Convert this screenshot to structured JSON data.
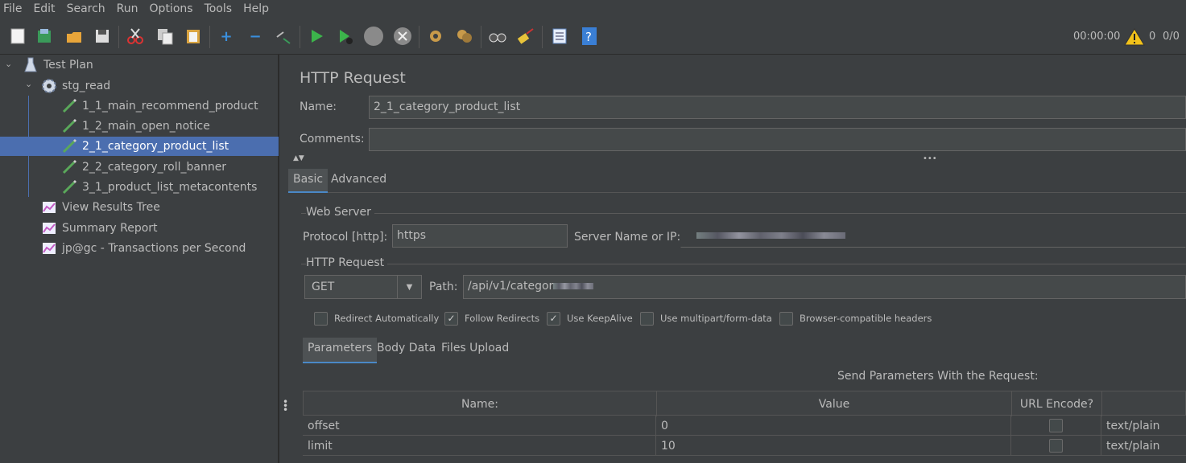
{
  "menu": [
    "File",
    "Edit",
    "Search",
    "Run",
    "Options",
    "Tools",
    "Help"
  ],
  "toolbar": {
    "icons": [
      "new-icon",
      "templates-icon",
      "open-icon",
      "save-icon",
      "cut-icon",
      "copy-icon",
      "paste-icon",
      "expand-icon",
      "collapse-icon",
      "toggle-icon",
      "start-icon",
      "start-no-pause-icon",
      "stop-icon",
      "shutdown-icon",
      "clear-icon",
      "clear-all-icon",
      "search-icon",
      "reset-search-icon",
      "function-helper-icon",
      "help-icon"
    ],
    "timer": "00:00:00",
    "warnings": "0",
    "threads": "0/0"
  },
  "tree": {
    "root": "Test Plan",
    "thread_group": "stg_read",
    "samplers": [
      "1_1_main_recommend_product",
      "1_2_main_open_notice",
      "2_1_category_product_list",
      "2_2_category_roll_banner",
      "3_1_product_list_metacontents"
    ],
    "selected_index": 2,
    "listeners": [
      "View Results Tree",
      "Summary Report",
      "jp@gc - Transactions per Second"
    ]
  },
  "panel": {
    "title": "HTTP Request",
    "name_label": "Name:",
    "name_value": "2_1_category_product_list",
    "comments_label": "Comments:",
    "comments_value": "",
    "tabs": [
      "Basic",
      "Advanced"
    ],
    "web_server_label": "Web Server",
    "protocol_label": "Protocol [http]:",
    "protocol_value": "https",
    "server_label": "Server Name or IP:",
    "http_request_label": "HTTP Request",
    "method": "GET",
    "path_label": "Path:",
    "path_value": "/api/v1/categor",
    "checkboxes": [
      {
        "label": "Redirect Automatically",
        "checked": false
      },
      {
        "label": "Follow Redirects",
        "checked": true
      },
      {
        "label": "Use KeepAlive",
        "checked": true
      },
      {
        "label": "Use multipart/form-data",
        "checked": false
      },
      {
        "label": "Browser-compatible headers",
        "checked": false
      }
    ],
    "subtabs": [
      "Parameters",
      "Body Data",
      "Files Upload"
    ],
    "send_params_label": "Send Parameters With the Request:",
    "columns": [
      "Name:",
      "Value",
      "URL Encode?"
    ],
    "rows": [
      {
        "name": "offset",
        "value": "0",
        "encode": false,
        "content_type": "text/plain"
      },
      {
        "name": "limit",
        "value": "10",
        "encode": false,
        "content_type": "text/plain"
      }
    ]
  }
}
